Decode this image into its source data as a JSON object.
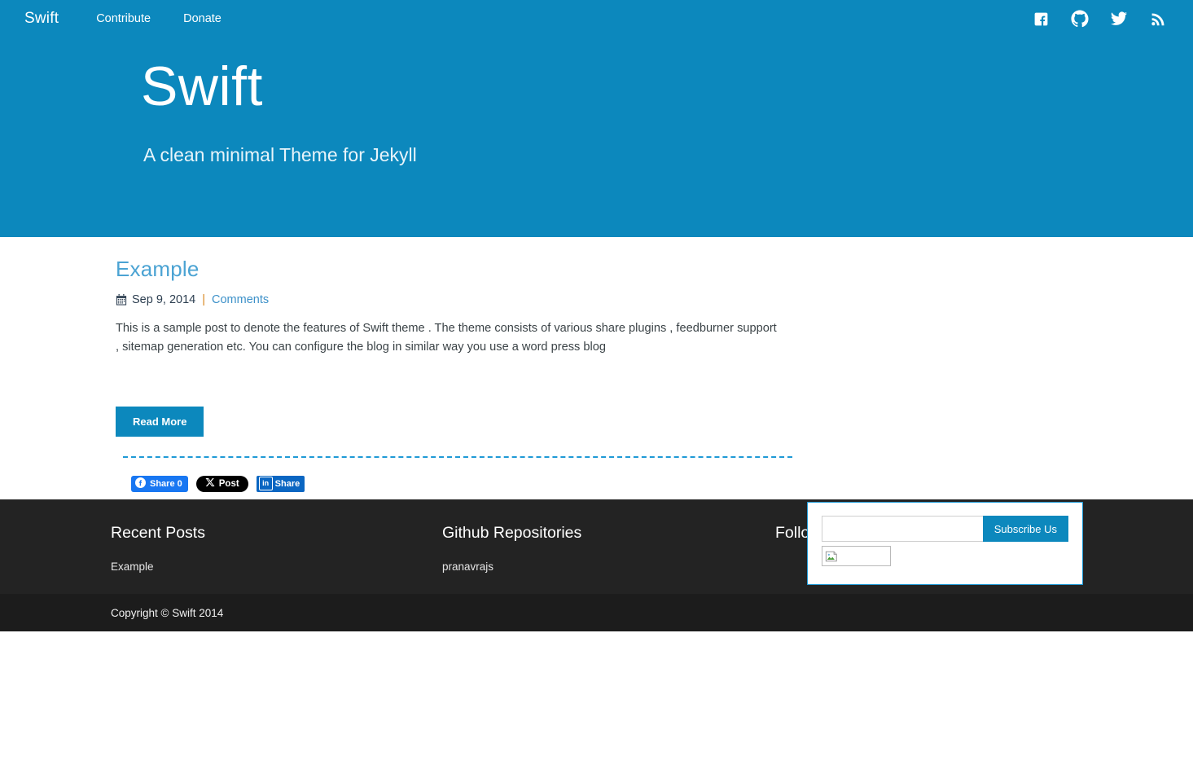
{
  "nav": {
    "brand": "Swift",
    "links": [
      {
        "label": "Contribute",
        "name": "nav-link-contribute"
      },
      {
        "label": "Donate",
        "name": "nav-link-donate"
      }
    ],
    "social": [
      {
        "icon": "facebook-icon",
        "label": "Facebook"
      },
      {
        "icon": "github-icon",
        "label": "GitHub"
      },
      {
        "icon": "twitter-icon",
        "label": "Twitter"
      },
      {
        "icon": "rss-icon",
        "label": "RSS"
      }
    ]
  },
  "hero": {
    "title": "Swift",
    "subtitle": "A clean minimal Theme for Jekyll",
    "background_color": "#0c88bd"
  },
  "post": {
    "title": "Example",
    "date": "Sep 9, 2014",
    "separator": "|",
    "comments_label": "Comments",
    "date_icon": "calendar-icon",
    "body": "This is a sample post to denote the features of Swift theme . The theme consists of various share plugins , feedburner support , sitemap generation etc. You can configure the blog in similar way you use a word press blog",
    "read_more_label": "Read More"
  },
  "share": {
    "facebook": {
      "label": "Share 0",
      "icon": "facebook-icon",
      "color": "#1877f2"
    },
    "twitter": {
      "label": "Post",
      "icon": "x-icon",
      "color": "#000000"
    },
    "linkedin": {
      "label": "Share",
      "icon": "linkedin-icon",
      "badge": "in",
      "color": "#0a66c2"
    }
  },
  "sidebar": {
    "subscribe": {
      "input_value": "",
      "input_placeholder": "",
      "button_label": "Subscribe Us",
      "image_alt": "broken-image-icon"
    }
  },
  "footer": {
    "columns": [
      {
        "heading": "Recent Posts",
        "items": [
          "Example"
        ]
      },
      {
        "heading": "Github Repositories",
        "items": [
          "pranavrajs"
        ]
      },
      {
        "heading": "Follow Us Here",
        "items": []
      }
    ],
    "copyright": "Copyright © Swift 2014"
  }
}
